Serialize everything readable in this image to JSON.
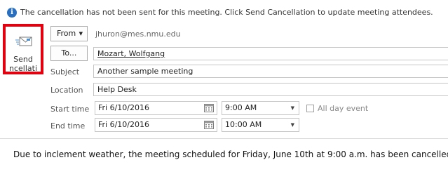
{
  "infobar": {
    "message": "The cancellation has not been sent for this meeting. Click Send Cancellation to update meeting attendees."
  },
  "send_button": {
    "label_line1": "Send",
    "label_line2": "ncellati"
  },
  "from": {
    "button_label": "From",
    "value": "jhuron@mes.nmu.edu"
  },
  "to": {
    "button_label": "To...",
    "value": "Mozart, Wolfgang"
  },
  "subject": {
    "label": "Subject",
    "value": "Another sample meeting"
  },
  "location": {
    "label": "Location",
    "value": "Help Desk"
  },
  "start": {
    "label": "Start time",
    "date": "Fri 6/10/2016",
    "time": "9:00 AM"
  },
  "end": {
    "label": "End time",
    "date": "Fri 6/10/2016",
    "time": "10:00 AM"
  },
  "all_day": {
    "label": "All day event",
    "checked": false
  },
  "body": {
    "text": "Due to inclement weather, the meeting scheduled for Friday, June 10th at 9:00 a.m. has been cancelled."
  },
  "colors": {
    "highlight_border": "#e3000f",
    "info_icon": "#2a6fbf"
  }
}
